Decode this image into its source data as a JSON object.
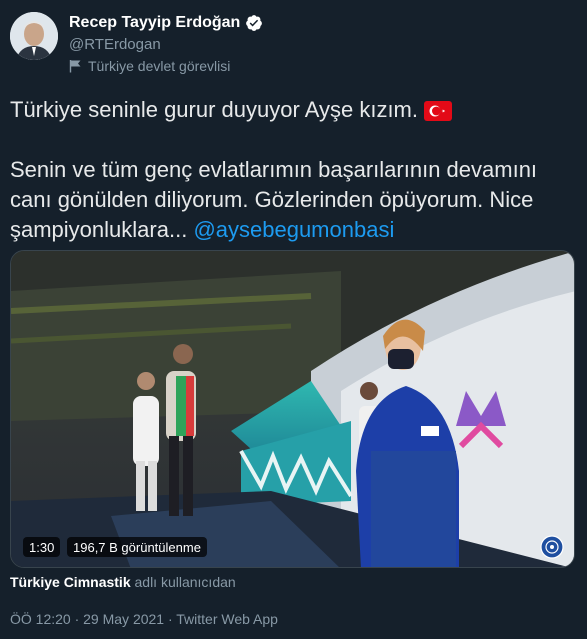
{
  "author": {
    "name": "Recep Tayyip Erdoğan",
    "handle": "@RTErdogan",
    "label": "Türkiye devlet görevlisi",
    "verified": true
  },
  "tweet": {
    "line1": "Türkiye seninle gurur duyuyor Ayşe kızım.",
    "flag_icon": "turkey-flag-emoji",
    "line2": "Senin ve tüm genç evlatlarımın başarılarının devamını",
    "line3": "canı gönülden diliyorum. Gözlerinden öpüyorum. Nice",
    "line4_prefix": "şampiyonluklara...",
    "mention": "@aysebegumonbasi"
  },
  "media": {
    "duration": "1:30",
    "views": "196,7 B görüntülenme"
  },
  "attribution": {
    "source": "Türkiye Cimnastik",
    "suffix": "adlı kullanıcıdan"
  },
  "meta": {
    "timestamp": "ÖÖ 12:20 · 29 May 2021 · Twitter Web App"
  },
  "colors": {
    "background": "#15202b",
    "accent": "#1d9bf0",
    "secondary_text": "#8899a6"
  }
}
